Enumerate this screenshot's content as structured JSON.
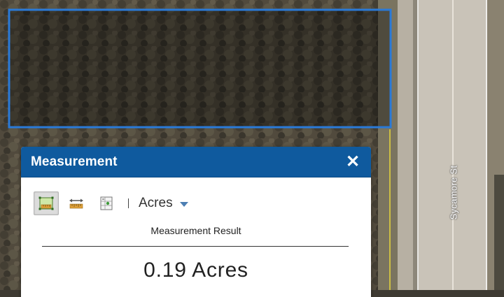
{
  "map": {
    "street_name": "Sycamore St",
    "measured_area_color": "#2a7ad8"
  },
  "panel": {
    "title": "Measurement",
    "close_icon": "close-icon",
    "tools": [
      {
        "name": "area-tool",
        "icon": "area-measure-icon",
        "active": true
      },
      {
        "name": "distance-tool",
        "icon": "distance-measure-icon",
        "active": false
      },
      {
        "name": "location-tool",
        "icon": "location-coordinates-icon",
        "active": false
      }
    ],
    "unit": "Acres",
    "result_label": "Measurement Result",
    "result_value": "0.19 Acres"
  },
  "colors": {
    "header": "#0f5a9e",
    "active_tool_bg": "#dcdcdc",
    "caret": "#4d7fb3"
  }
}
